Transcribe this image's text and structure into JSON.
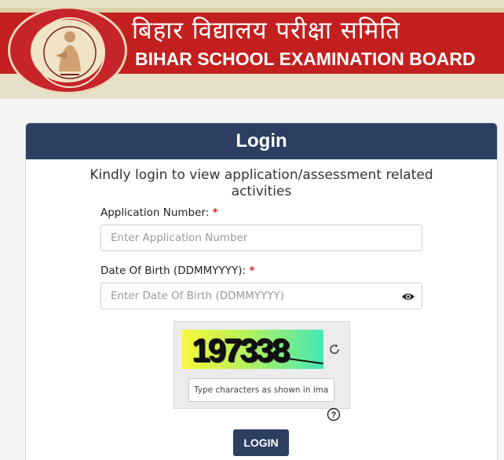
{
  "header": {
    "title_hindi": "बिहार विद्यालय परीक्षा समिति",
    "title_english": "BIHAR SCHOOL EXAMINATION BOARD",
    "logo_icon": "bseb-emblem-icon"
  },
  "login": {
    "heading": "Login",
    "subtitle": "Kindly login to view application/assessment related activities",
    "application_number": {
      "label": "Application Number:",
      "required_mark": "*",
      "placeholder": "Enter Application Number",
      "value": ""
    },
    "dob": {
      "label": "Date Of Birth (DDMMYYYY):",
      "required_mark": "*",
      "placeholder": "Enter Date Of Birth (DDMMYYYY)",
      "value": "",
      "toggle_icon": "eye-icon"
    },
    "captcha": {
      "code": "197338",
      "refresh_icon": "refresh-icon",
      "input_placeholder": "Type characters as shown in image",
      "help_icon": "help-icon"
    },
    "submit_label": "LOGIN"
  },
  "colors": {
    "header_red": "#c31f1f",
    "header_bg": "#e6e1c6",
    "primary_navy": "#2c3e61",
    "required_red": "#e02020"
  }
}
